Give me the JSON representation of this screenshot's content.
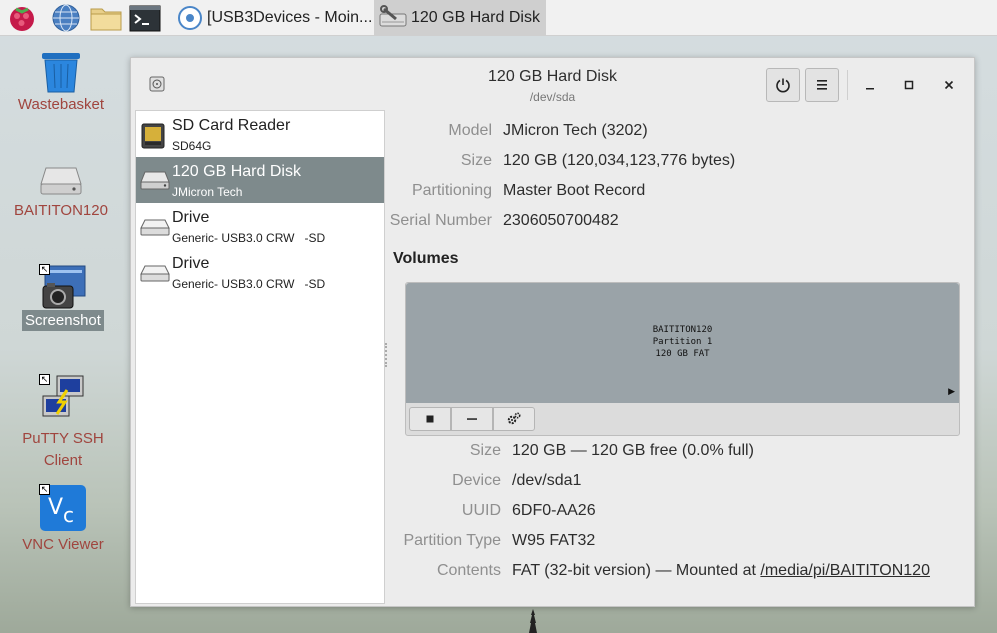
{
  "taskbar": {
    "icons": [
      "raspberry-menu-icon",
      "globe-browser-icon",
      "folder-icon",
      "terminal-icon"
    ],
    "tasks": [
      {
        "label": "[USB3Devices - Moin...",
        "icon": "chromium-icon",
        "active": false
      },
      {
        "label": "120 GB Hard Disk",
        "icon": "disks-icon",
        "active": true
      }
    ]
  },
  "desktop": {
    "icons": [
      {
        "label": "Wastebasket",
        "icon": "wastebasket-icon"
      },
      {
        "label": "BAITITON120",
        "icon": "drive-icon"
      },
      {
        "label": "Screenshot",
        "icon": "screenshot-icon",
        "selected": true
      },
      {
        "label": "PuTTY SSH Client",
        "line1": "PuTTY SSH",
        "line2": "Client",
        "icon": "putty-icon"
      },
      {
        "label": "VNC Viewer",
        "icon": "vnc-icon"
      }
    ]
  },
  "window": {
    "title": "120 GB Hard Disk",
    "subtitle": "/dev/sda",
    "devices": [
      {
        "name": "SD Card Reader",
        "sub": "SD64G",
        "icon": "sd-card-icon",
        "selected": false
      },
      {
        "name": "120 GB Hard Disk",
        "sub": "JMicron Tech",
        "icon": "hard-disk-icon",
        "selected": true
      },
      {
        "name": "Drive",
        "sub": "Generic- USB3.0 CRW   -SD",
        "icon": "drive-icon",
        "selected": false
      },
      {
        "name": "Drive",
        "sub": "Generic- USB3.0 CRW   -SD",
        "icon": "drive-icon",
        "selected": false
      }
    ],
    "info": {
      "model": {
        "label": "Model",
        "value": "JMicron Tech (3202)"
      },
      "size": {
        "label": "Size",
        "value": "120 GB (120,034,123,776 bytes)"
      },
      "partitioning": {
        "label": "Partitioning",
        "value": "Master Boot Record"
      },
      "serial": {
        "label": "Serial Number",
        "value": "2306050700482"
      }
    },
    "volumes": {
      "title": "Volumes",
      "partition": {
        "name": "BAITITON120",
        "number": "Partition 1",
        "desc": "120 GB FAT"
      },
      "details": {
        "size": {
          "label": "Size",
          "value": "120 GB — 120 GB free (0.0% full)"
        },
        "device": {
          "label": "Device",
          "value": "/dev/sda1"
        },
        "uuid": {
          "label": "UUID",
          "value": "6DF0-AA26"
        },
        "ptype": {
          "label": "Partition Type",
          "value": "W95 FAT32"
        },
        "contents": {
          "label": "Contents",
          "value_prefix": "FAT (32-bit version) — Mounted at ",
          "link": "/media/pi/BAITITON120"
        }
      }
    }
  }
}
